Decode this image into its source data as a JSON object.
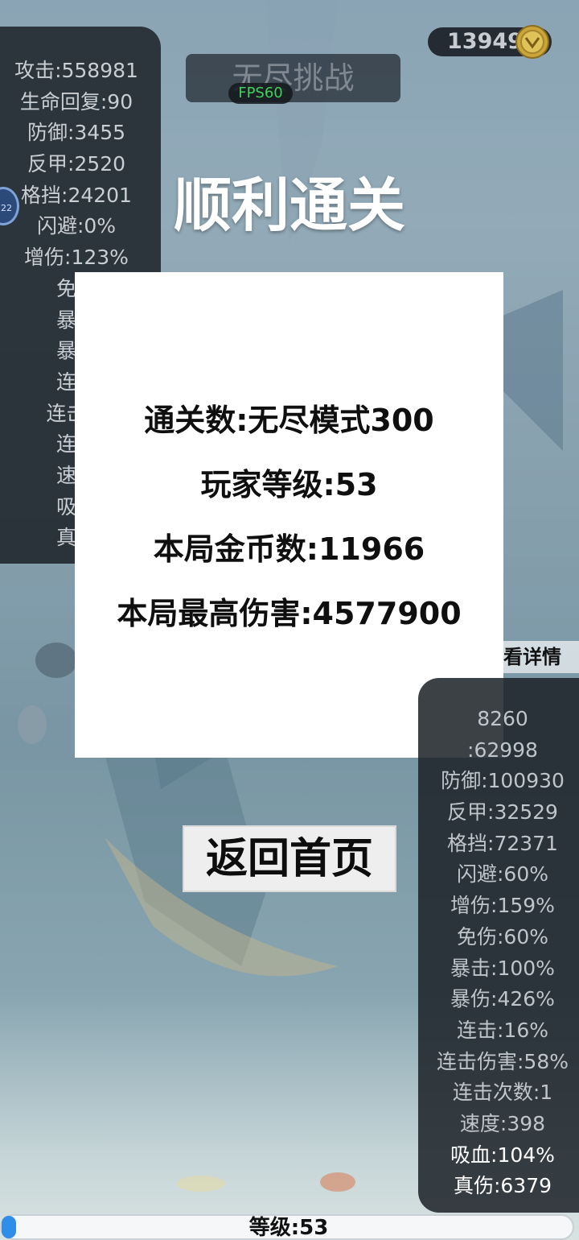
{
  "header": {
    "coins": "13949",
    "mode_title": "无尽挑战",
    "fps": "FPS60"
  },
  "left_stats": [
    "攻击:558981",
    "生命回复:90",
    "防御:3455",
    "反甲:2520",
    "格挡:24201",
    "闪避:0%",
    "增伤:123%",
    "免伤",
    "暴击",
    "暴伤",
    "连击",
    "连击伤",
    "连击",
    "速度",
    "吸血",
    "真伤"
  ],
  "victory": {
    "title": "顺利通关"
  },
  "result": {
    "clear_count": "通关数:无尽模式300",
    "player_level": "玩家等级:53",
    "round_coins": "本局金币数:11966",
    "max_damage": "本局最高伤害:4577900"
  },
  "detail_link": "看详情",
  "right_stats": [
    "8260",
    ":62998",
    "防御:100930",
    "反甲:32529",
    "格挡:72371",
    "闪避:60%",
    "增伤:159%",
    "免伤:60%",
    "暴击:100%",
    "暴伤:426%",
    "连击:16%",
    "连击伤害:58%",
    "连击次数:1",
    "速度:398",
    "吸血:104%",
    "真伤:6379"
  ],
  "home_button": "返回首页",
  "level_bar": {
    "label": "等级:53",
    "progress": 0.02
  },
  "colors": {
    "fps_green": "#3fd15a",
    "level_fill": "#2f8fe8",
    "panel_bg": "#1c2228"
  }
}
